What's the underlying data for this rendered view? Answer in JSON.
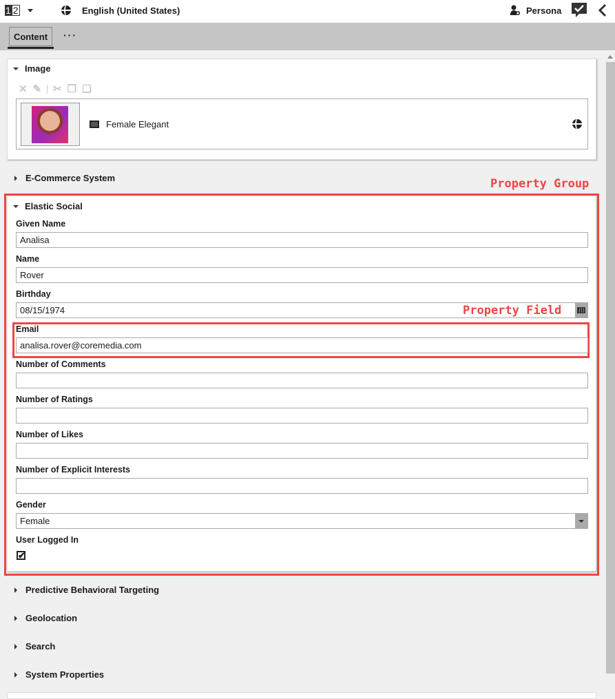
{
  "topbar": {
    "version_icon": {
      "first": "1",
      "second": "2"
    },
    "language": "English (United States)",
    "persona_label": "Persona"
  },
  "tabs": [
    {
      "label": "Content",
      "active": true
    }
  ],
  "tab_more": "···",
  "image_section": {
    "title": "Image",
    "toolbar_icons": [
      "remove-icon",
      "edit-icon",
      "cut-icon",
      "copy-icon",
      "paste-icon"
    ],
    "item_label": "Female Elegant"
  },
  "collapsed_sections_top": [
    {
      "label": "E-Commerce System"
    }
  ],
  "elastic_social": {
    "title": "Elastic Social",
    "fields": [
      {
        "label": "Given Name",
        "value": "Analisa"
      },
      {
        "label": "Name",
        "value": "Rover"
      },
      {
        "label": "Birthday",
        "value": "08/15/1974"
      },
      {
        "label": "Email",
        "value": "analisa.rover@coremedia.com"
      },
      {
        "label": "Number of Comments",
        "value": ""
      },
      {
        "label": "Number of Ratings",
        "value": ""
      },
      {
        "label": "Number of Likes",
        "value": ""
      },
      {
        "label": "Number of Explicit Interests",
        "value": ""
      },
      {
        "label": "Gender",
        "value": "Female"
      }
    ],
    "checkbox": {
      "label": "User Logged In",
      "checked": true,
      "mark": "✔"
    }
  },
  "collapsed_sections_bottom": [
    {
      "label": "Predictive Behavioral Targeting"
    },
    {
      "label": "Geolocation"
    },
    {
      "label": "Search"
    },
    {
      "label": "System Properties"
    }
  ],
  "annotations": {
    "group": "Property Group",
    "field": "Property Field",
    "color": "#f04444"
  }
}
